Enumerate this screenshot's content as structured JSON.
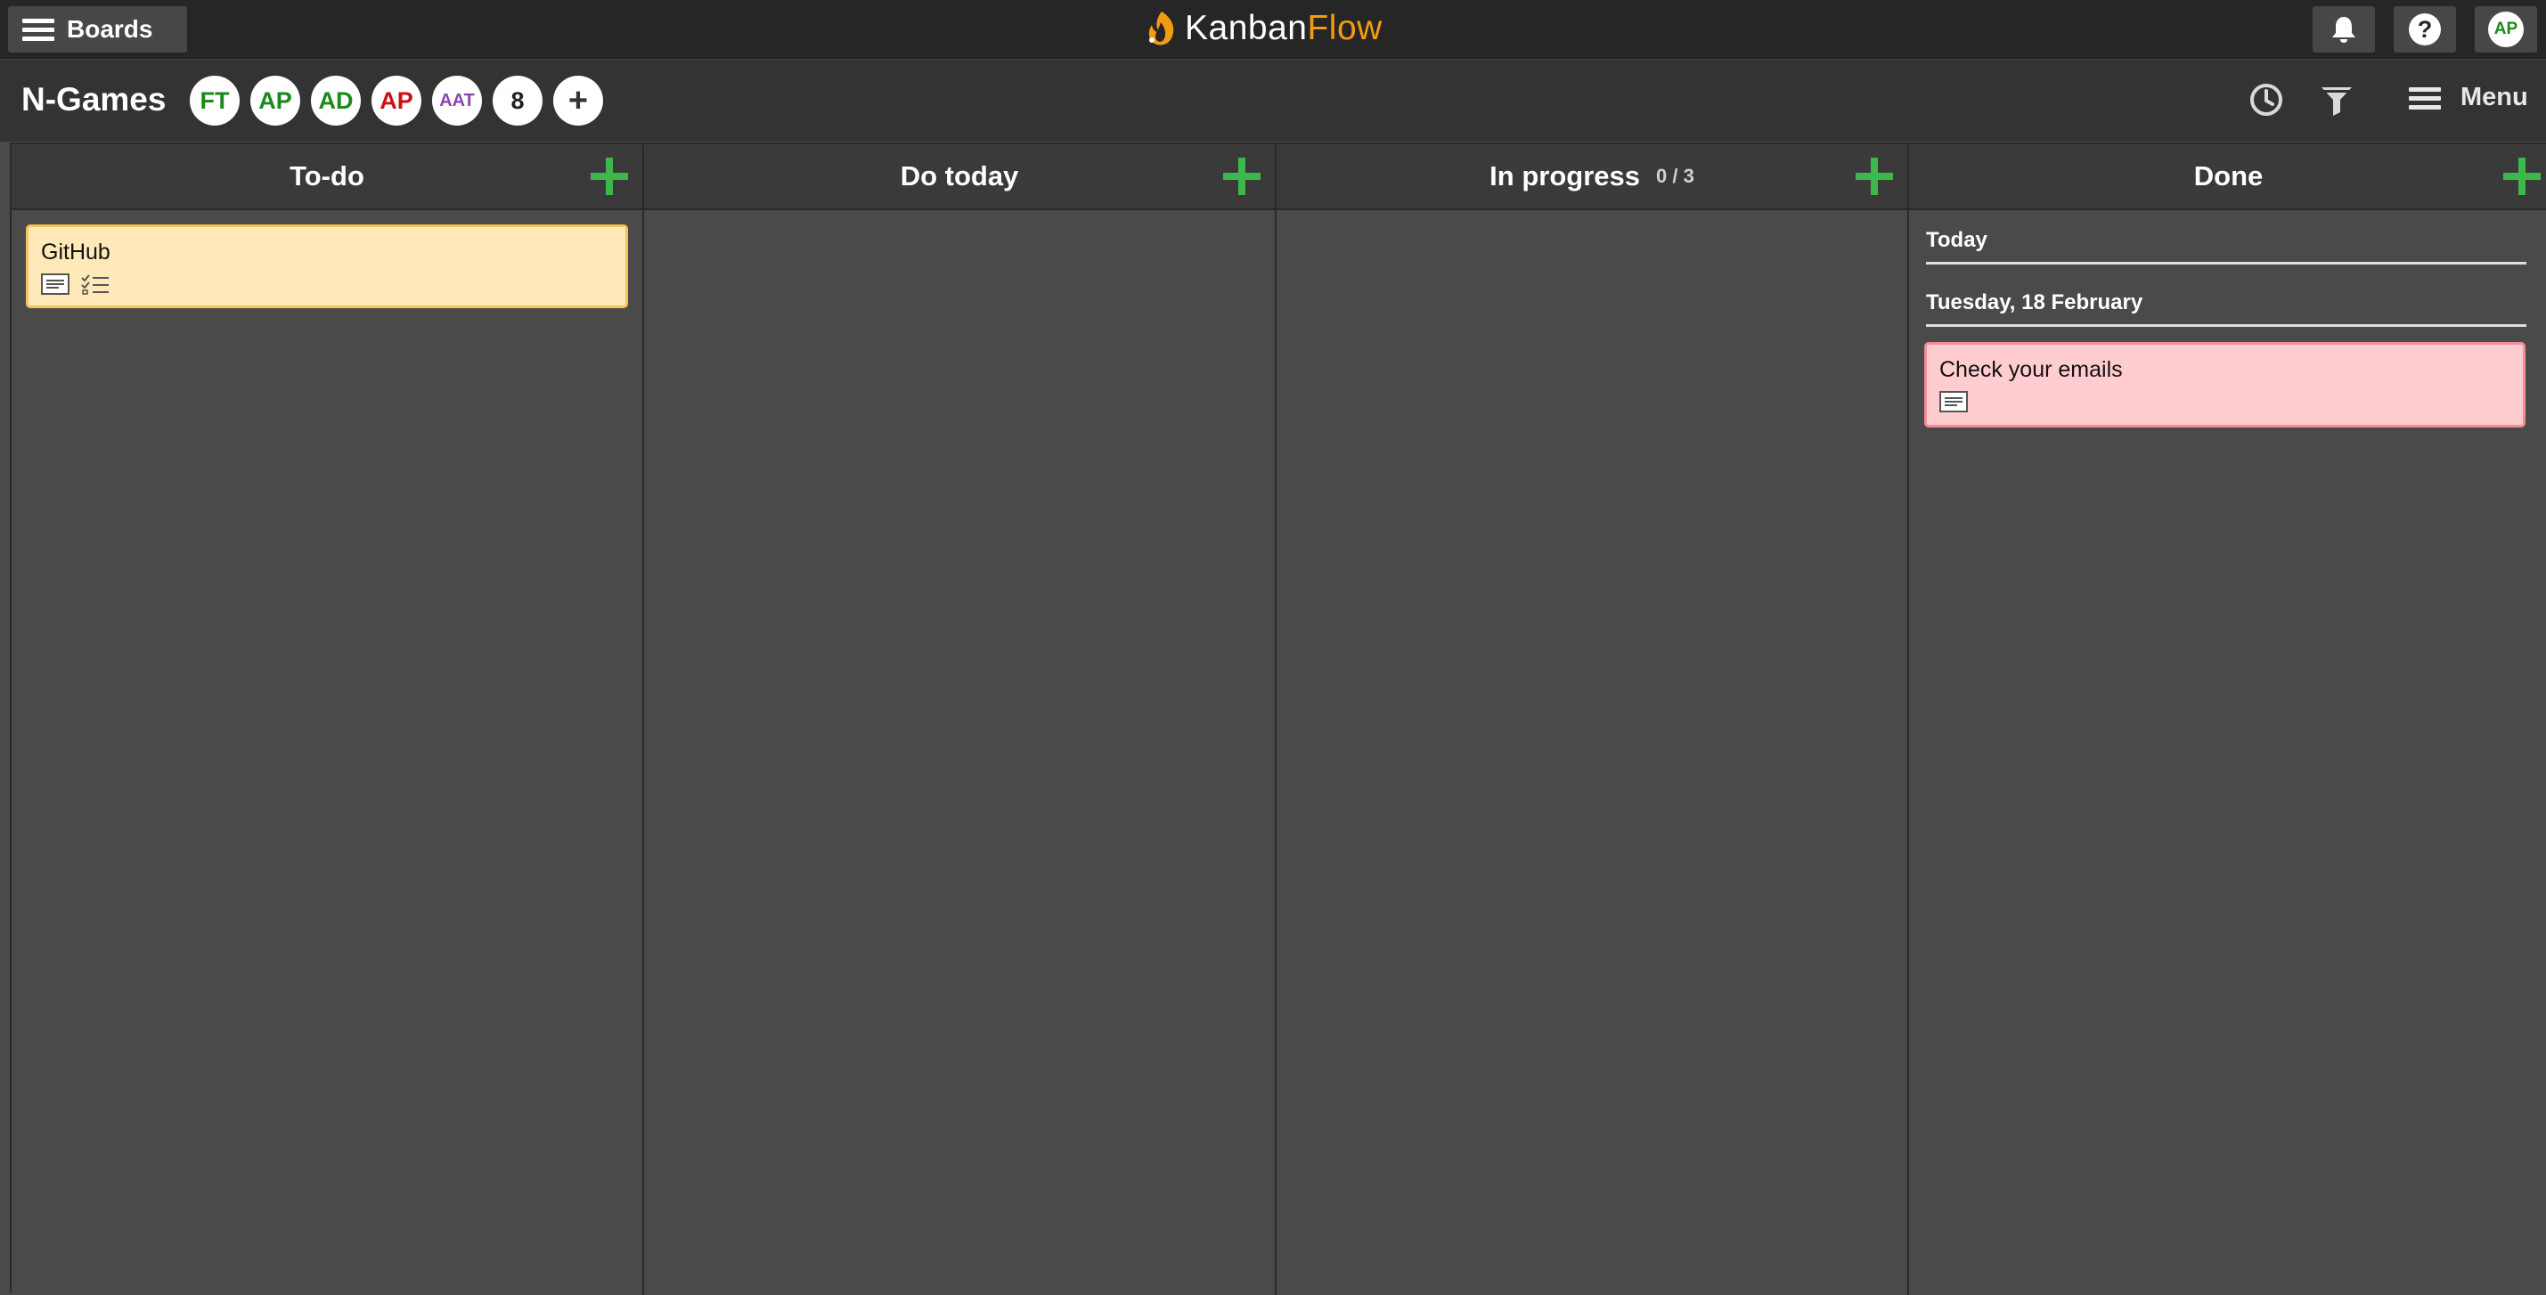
{
  "topbar": {
    "boards_label": "Boards",
    "logo_part1": "Kanban",
    "logo_part2": "Flow",
    "help_label": "?",
    "user_initials": "AP"
  },
  "board": {
    "title": "N-Games",
    "members": [
      {
        "initials": "FT",
        "color": "#1a8a1a"
      },
      {
        "initials": "AP",
        "color": "#1a8a1a"
      },
      {
        "initials": "AD",
        "color": "#1a8a1a"
      },
      {
        "initials": "AP",
        "color": "#cc1111"
      },
      {
        "initials": "AAT",
        "color": "#8e44ad"
      },
      {
        "initials": "8",
        "color": "#222222"
      }
    ],
    "add_member_label": "+",
    "menu_label": "Menu"
  },
  "columns": [
    {
      "title": "To-do"
    },
    {
      "title": "Do today"
    },
    {
      "title": "In progress",
      "wip": "0 / 3"
    },
    {
      "title": "Done"
    }
  ],
  "cards": {
    "todo_card": {
      "title": "GitHub",
      "color": "#ffe9b8"
    },
    "done_card": {
      "title": "Check your emails",
      "color": "#ffcccf"
    }
  },
  "done_groups": {
    "today": "Today",
    "date": "Tuesday, 18 February"
  },
  "colors": {
    "accent_green": "#3cb94a",
    "logo_orange": "#f39c12",
    "topbar_bg": "#262626",
    "column_bg": "#4a4a4a"
  }
}
